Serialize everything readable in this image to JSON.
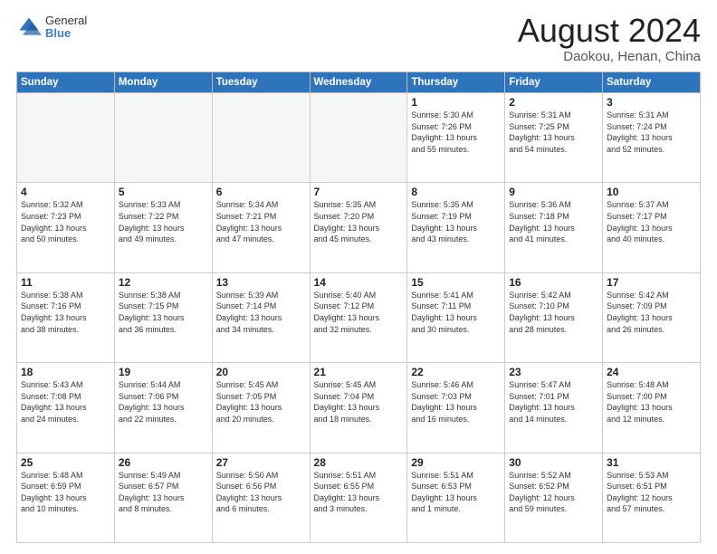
{
  "header": {
    "logo_general": "General",
    "logo_blue": "Blue",
    "month_title": "August 2024",
    "location": "Daokou, Henan, China"
  },
  "days_of_week": [
    "Sunday",
    "Monday",
    "Tuesday",
    "Wednesday",
    "Thursday",
    "Friday",
    "Saturday"
  ],
  "weeks": [
    [
      {
        "day": "",
        "info": ""
      },
      {
        "day": "",
        "info": ""
      },
      {
        "day": "",
        "info": ""
      },
      {
        "day": "",
        "info": ""
      },
      {
        "day": "1",
        "info": "Sunrise: 5:30 AM\nSunset: 7:26 PM\nDaylight: 13 hours\nand 55 minutes."
      },
      {
        "day": "2",
        "info": "Sunrise: 5:31 AM\nSunset: 7:25 PM\nDaylight: 13 hours\nand 54 minutes."
      },
      {
        "day": "3",
        "info": "Sunrise: 5:31 AM\nSunset: 7:24 PM\nDaylight: 13 hours\nand 52 minutes."
      }
    ],
    [
      {
        "day": "4",
        "info": "Sunrise: 5:32 AM\nSunset: 7:23 PM\nDaylight: 13 hours\nand 50 minutes."
      },
      {
        "day": "5",
        "info": "Sunrise: 5:33 AM\nSunset: 7:22 PM\nDaylight: 13 hours\nand 49 minutes."
      },
      {
        "day": "6",
        "info": "Sunrise: 5:34 AM\nSunset: 7:21 PM\nDaylight: 13 hours\nand 47 minutes."
      },
      {
        "day": "7",
        "info": "Sunrise: 5:35 AM\nSunset: 7:20 PM\nDaylight: 13 hours\nand 45 minutes."
      },
      {
        "day": "8",
        "info": "Sunrise: 5:35 AM\nSunset: 7:19 PM\nDaylight: 13 hours\nand 43 minutes."
      },
      {
        "day": "9",
        "info": "Sunrise: 5:36 AM\nSunset: 7:18 PM\nDaylight: 13 hours\nand 41 minutes."
      },
      {
        "day": "10",
        "info": "Sunrise: 5:37 AM\nSunset: 7:17 PM\nDaylight: 13 hours\nand 40 minutes."
      }
    ],
    [
      {
        "day": "11",
        "info": "Sunrise: 5:38 AM\nSunset: 7:16 PM\nDaylight: 13 hours\nand 38 minutes."
      },
      {
        "day": "12",
        "info": "Sunrise: 5:38 AM\nSunset: 7:15 PM\nDaylight: 13 hours\nand 36 minutes."
      },
      {
        "day": "13",
        "info": "Sunrise: 5:39 AM\nSunset: 7:14 PM\nDaylight: 13 hours\nand 34 minutes."
      },
      {
        "day": "14",
        "info": "Sunrise: 5:40 AM\nSunset: 7:12 PM\nDaylight: 13 hours\nand 32 minutes."
      },
      {
        "day": "15",
        "info": "Sunrise: 5:41 AM\nSunset: 7:11 PM\nDaylight: 13 hours\nand 30 minutes."
      },
      {
        "day": "16",
        "info": "Sunrise: 5:42 AM\nSunset: 7:10 PM\nDaylight: 13 hours\nand 28 minutes."
      },
      {
        "day": "17",
        "info": "Sunrise: 5:42 AM\nSunset: 7:09 PM\nDaylight: 13 hours\nand 26 minutes."
      }
    ],
    [
      {
        "day": "18",
        "info": "Sunrise: 5:43 AM\nSunset: 7:08 PM\nDaylight: 13 hours\nand 24 minutes."
      },
      {
        "day": "19",
        "info": "Sunrise: 5:44 AM\nSunset: 7:06 PM\nDaylight: 13 hours\nand 22 minutes."
      },
      {
        "day": "20",
        "info": "Sunrise: 5:45 AM\nSunset: 7:05 PM\nDaylight: 13 hours\nand 20 minutes."
      },
      {
        "day": "21",
        "info": "Sunrise: 5:45 AM\nSunset: 7:04 PM\nDaylight: 13 hours\nand 18 minutes."
      },
      {
        "day": "22",
        "info": "Sunrise: 5:46 AM\nSunset: 7:03 PM\nDaylight: 13 hours\nand 16 minutes."
      },
      {
        "day": "23",
        "info": "Sunrise: 5:47 AM\nSunset: 7:01 PM\nDaylight: 13 hours\nand 14 minutes."
      },
      {
        "day": "24",
        "info": "Sunrise: 5:48 AM\nSunset: 7:00 PM\nDaylight: 13 hours\nand 12 minutes."
      }
    ],
    [
      {
        "day": "25",
        "info": "Sunrise: 5:48 AM\nSunset: 6:59 PM\nDaylight: 13 hours\nand 10 minutes."
      },
      {
        "day": "26",
        "info": "Sunrise: 5:49 AM\nSunset: 6:57 PM\nDaylight: 13 hours\nand 8 minutes."
      },
      {
        "day": "27",
        "info": "Sunrise: 5:50 AM\nSunset: 6:56 PM\nDaylight: 13 hours\nand 6 minutes."
      },
      {
        "day": "28",
        "info": "Sunrise: 5:51 AM\nSunset: 6:55 PM\nDaylight: 13 hours\nand 3 minutes."
      },
      {
        "day": "29",
        "info": "Sunrise: 5:51 AM\nSunset: 6:53 PM\nDaylight: 13 hours\nand 1 minute."
      },
      {
        "day": "30",
        "info": "Sunrise: 5:52 AM\nSunset: 6:52 PM\nDaylight: 12 hours\nand 59 minutes."
      },
      {
        "day": "31",
        "info": "Sunrise: 5:53 AM\nSunset: 6:51 PM\nDaylight: 12 hours\nand 57 minutes."
      }
    ]
  ]
}
